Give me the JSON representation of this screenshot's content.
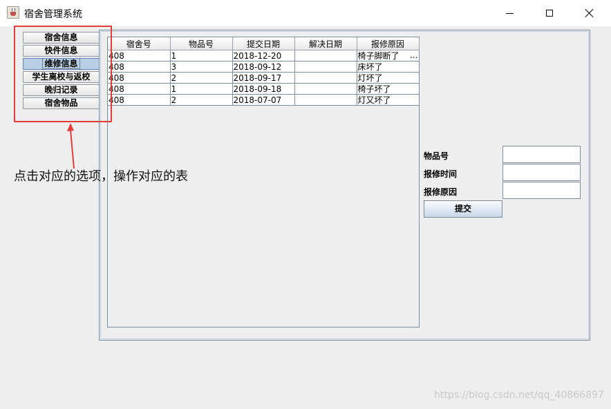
{
  "window": {
    "title": "宿舍管理系统",
    "icon": "java-cup-icon",
    "controls": {
      "minimize": "minimize-icon",
      "maximize": "maximize-icon",
      "close": "close-icon"
    }
  },
  "tabs": [
    {
      "label": "宿舍信息",
      "selected": false
    },
    {
      "label": "快件信息",
      "selected": false
    },
    {
      "label": "维修信息",
      "selected": true
    },
    {
      "label": "学生离校与返校",
      "selected": false
    },
    {
      "label": "晚归记录",
      "selected": false
    },
    {
      "label": "宿舍物品",
      "selected": false
    }
  ],
  "table": {
    "columns": [
      "宿舍号",
      "物品号",
      "提交日期",
      "解决日期",
      "报修原因"
    ],
    "rows": [
      [
        "408",
        "1",
        "2018-12-20",
        "",
        "椅子脚断了"
      ],
      [
        "408",
        "3",
        "2018-09-12",
        "",
        "床坏了"
      ],
      [
        "408",
        "2",
        "2018-09-17",
        "",
        "灯坏了"
      ],
      [
        "408",
        "1",
        "2018-09-18",
        "",
        "椅子坏了"
      ],
      [
        "408",
        "2",
        "2018-07-07",
        "",
        "灯又坏了"
      ]
    ],
    "truncation_marker": "..."
  },
  "form": {
    "item_no_label": "物品号",
    "repair_time_label": "报修时间",
    "repair_reason_label": "报修原因",
    "item_no_value": "",
    "repair_time_value": "",
    "repair_reason_value": "",
    "submit_label": "提交"
  },
  "annotation": {
    "text": "点击对应的选项，操作对应的表",
    "color": "#e63b3b"
  },
  "watermark": "https://blog.csdn.net/qq_40866897",
  "colors": {
    "selected_tab": "#b8cfe5",
    "panel_border": "#7a8a99",
    "background": "#eeeeee"
  }
}
